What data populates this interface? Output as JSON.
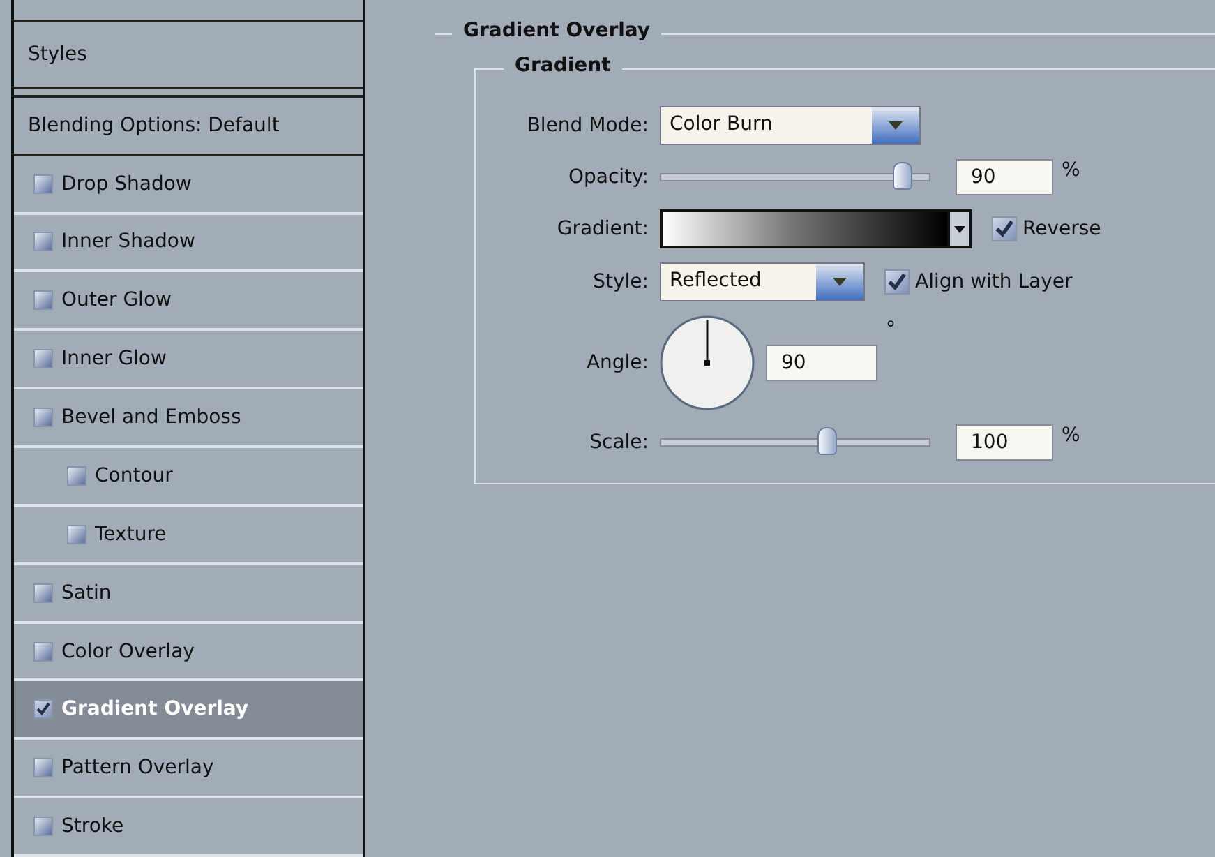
{
  "sidebar": {
    "headers": [
      {
        "label": "Styles",
        "selected": false
      },
      {
        "label": "Blending Options: Default",
        "selected": false
      }
    ],
    "items": [
      {
        "label": "Drop Shadow",
        "checked": false,
        "selected": false
      },
      {
        "label": "Inner Shadow",
        "checked": false,
        "selected": false
      },
      {
        "label": "Outer Glow",
        "checked": false,
        "selected": false
      },
      {
        "label": "Inner Glow",
        "checked": false,
        "selected": false
      },
      {
        "label": "Bevel and Emboss",
        "checked": false,
        "selected": false,
        "children": [
          {
            "label": "Contour",
            "checked": false,
            "selected": false
          },
          {
            "label": "Texture",
            "checked": false,
            "selected": false
          }
        ]
      },
      {
        "label": "Satin",
        "checked": false,
        "selected": false
      },
      {
        "label": "Color Overlay",
        "checked": false,
        "selected": false
      },
      {
        "label": "Gradient Overlay",
        "checked": true,
        "selected": true
      },
      {
        "label": "Pattern Overlay",
        "checked": false,
        "selected": false
      },
      {
        "label": "Stroke",
        "checked": false,
        "selected": false
      }
    ]
  },
  "panel": {
    "title": "Gradient Overlay",
    "group_title": "Gradient",
    "blend_mode": {
      "label": "Blend Mode:",
      "value": "Color Burn"
    },
    "opacity": {
      "label": "Opacity:",
      "level": 0.9,
      "value": "90",
      "unit": "%"
    },
    "gradient": {
      "label": "Gradient:",
      "reverse": {
        "label": "Reverse",
        "checked": true
      }
    },
    "style": {
      "label": "Style:",
      "value": "Reflected",
      "align": {
        "label": "Align with Layer",
        "checked": true
      }
    },
    "angle": {
      "label": "Angle:",
      "value": "90",
      "unit": "°"
    },
    "scale": {
      "label": "Scale:",
      "level": 0.62,
      "value": "100",
      "unit": "%"
    }
  }
}
